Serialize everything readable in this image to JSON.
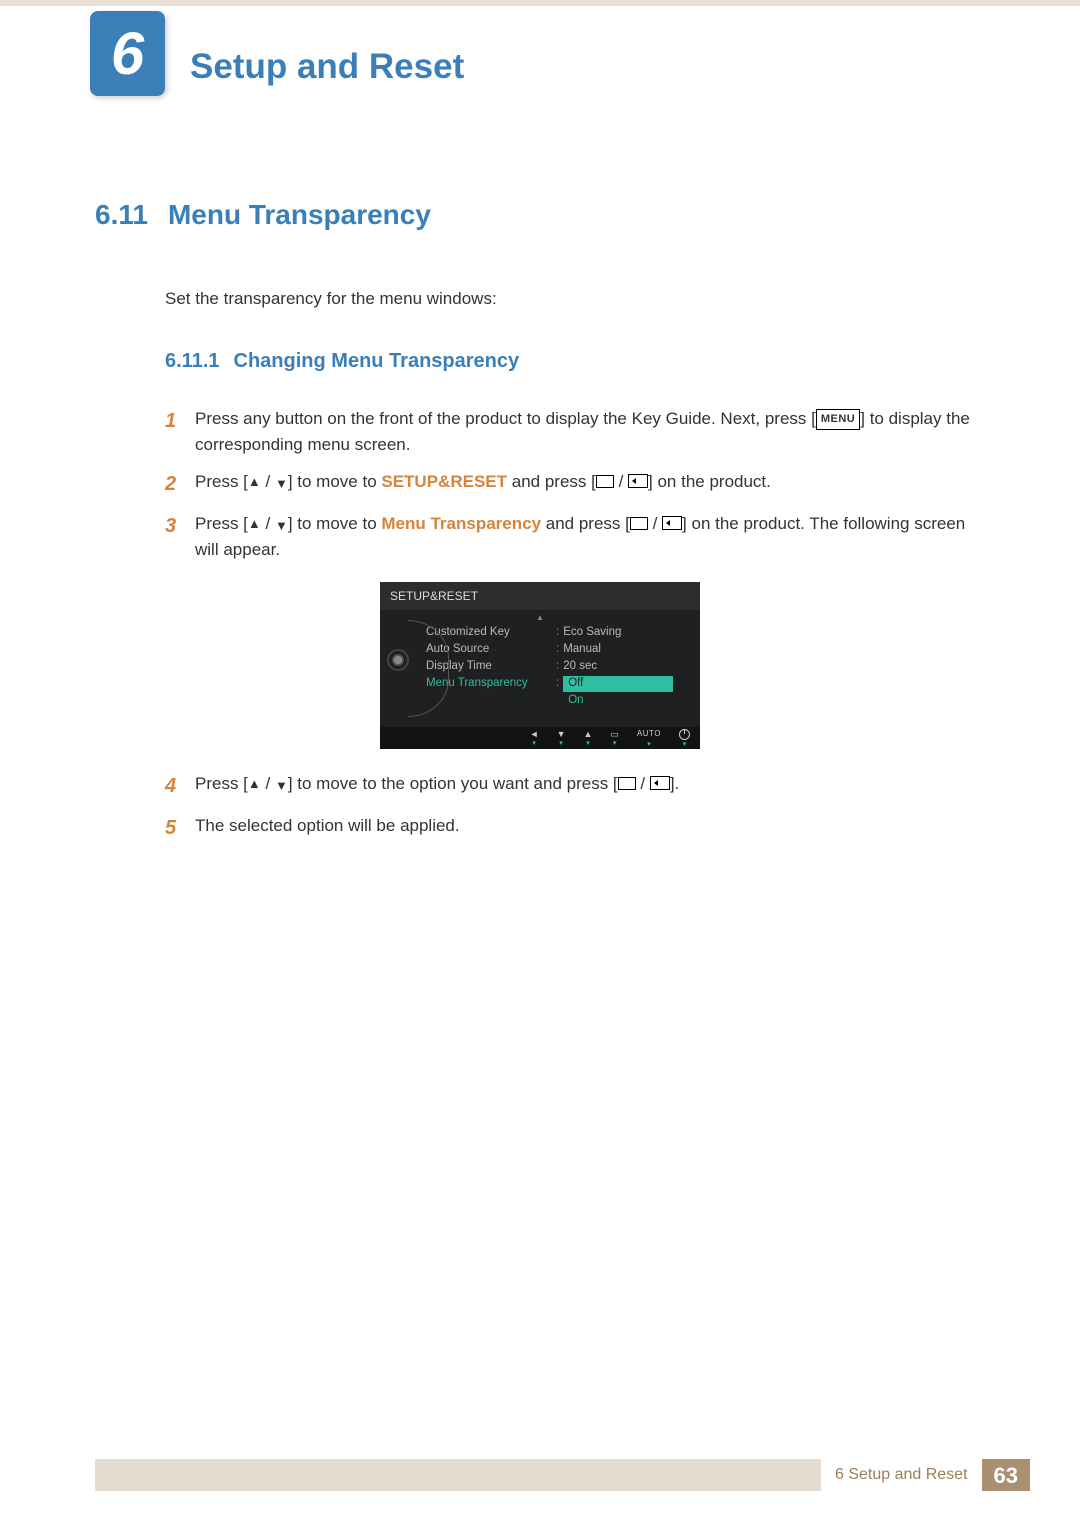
{
  "chapter": {
    "number": "6",
    "title": "Setup and Reset"
  },
  "section": {
    "number": "6.11",
    "title": "Menu Transparency"
  },
  "intro": "Set the transparency for the menu windows:",
  "subsection": {
    "number": "6.11.1",
    "title": "Changing Menu Transparency"
  },
  "steps": {
    "s1": {
      "num": "1",
      "t1": "Press any button on the front of the product to display the Key Guide. Next, press [",
      "menu_btn": "MENU",
      "t2": "] to display the corresponding menu screen."
    },
    "s2": {
      "num": "2",
      "t1": "Press [",
      "t2": "] to move to ",
      "kw": "SETUP&RESET",
      "t3": " and press [",
      "t4": "] on the product."
    },
    "s3": {
      "num": "3",
      "t1": "Press [",
      "t2": "] to move to ",
      "kw": "Menu Transparency",
      "t3": " and press [",
      "t4": "] on the product. The following screen will appear."
    },
    "s4": {
      "num": "4",
      "t1": "Press [",
      "t2": "] to move to the option you want and press [",
      "t3": "]."
    },
    "s5": {
      "num": "5",
      "t1": "The selected option will be applied."
    }
  },
  "osd": {
    "title": "SETUP&RESET",
    "rows": {
      "r1": {
        "label": "Customized Key",
        "value": "Eco Saving"
      },
      "r2": {
        "label": "Auto Source",
        "value": "Manual"
      },
      "r3": {
        "label": "Display Time",
        "value": "20 sec"
      },
      "r4": {
        "label": "Menu Transparency",
        "opt_selected": "Off",
        "opt_other": "On"
      }
    },
    "footer": {
      "auto": "AUTO"
    }
  },
  "footer": {
    "label": "6 Setup and Reset",
    "page": "63"
  }
}
